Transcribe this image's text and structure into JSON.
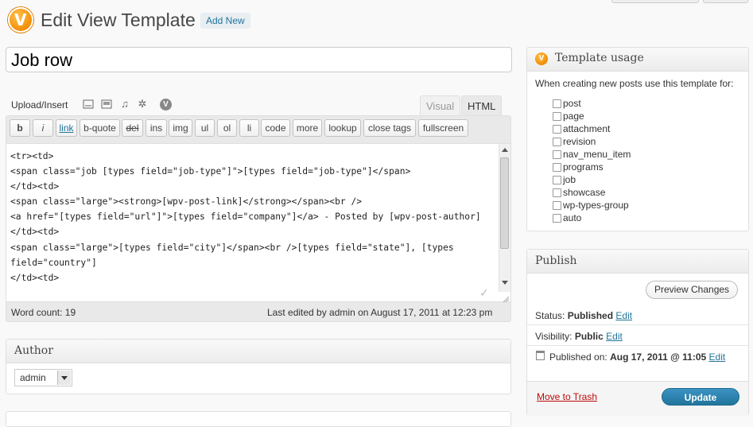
{
  "header": {
    "title": "Edit View Template",
    "add_new": "Add New"
  },
  "post_title": {
    "value": "Job row"
  },
  "media": {
    "upload_label": "Upload/Insert",
    "icons": [
      "image-icon",
      "video-icon",
      "audio-icon",
      "media-icon",
      "views-icon"
    ]
  },
  "editor_tabs": {
    "visual": "Visual",
    "html": "HTML",
    "active": "HTML"
  },
  "quicktags": [
    "b",
    "i",
    "link",
    "b-quote",
    "del",
    "ins",
    "img",
    "ul",
    "ol",
    "li",
    "code",
    "more",
    "lookup",
    "close tags",
    "fullscreen"
  ],
  "editor_content": "<tr><td>\n<span class=\"job [types field=\"job-type\"]\">[types field=\"job-type\"]</span>\n</td><td>\n<span class=\"large\"><strong>[wpv-post-link]</strong></span><br />\n<a href=\"[types field=\"url\"]\">[types field=\"company\"]</a> - Posted by [wpv-post-author]\n</td><td>\n<span class=\"large\">[types field=\"city\"]</span><br />[types field=\"state\"], [types field=\"country\"]\n</td><td>",
  "status_bar": {
    "word_count": "Word count: 19",
    "last_edited": "Last edited by admin on August 17, 2011 at 12:23 pm"
  },
  "author_box": {
    "title": "Author",
    "selected": "admin"
  },
  "template_usage": {
    "title": "Template usage",
    "description": "When creating new posts use this template for:",
    "post_types": [
      "post",
      "page",
      "attachment",
      "revision",
      "nav_menu_item",
      "programs",
      "job",
      "showcase",
      "wp-types-group",
      "auto"
    ]
  },
  "publish": {
    "title": "Publish",
    "preview": "Preview Changes",
    "status_label": "Status:",
    "status_value": "Published",
    "visibility_label": "Visibility:",
    "visibility_value": "Public",
    "published_label": "Published on:",
    "published_value": "Aug 17, 2011 @ 11:05",
    "edit": "Edit",
    "trash": "Move to Trash",
    "update": "Update"
  },
  "colors": {
    "link": "#21759b",
    "primary_button": "#21759b",
    "trash": "#bc0b0b",
    "logo": "#f28a00"
  }
}
